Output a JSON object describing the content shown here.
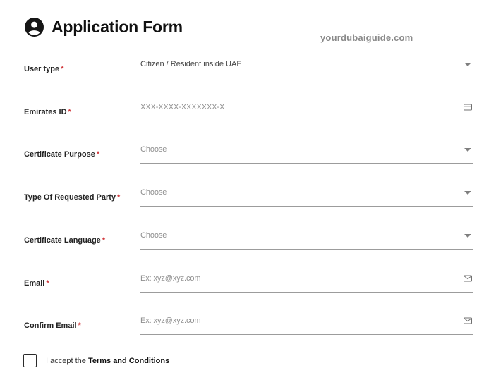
{
  "form": {
    "title": "Application Form",
    "watermark": "yourdubaiguide.com",
    "required_marker": "*",
    "fields": [
      {
        "label": "User type",
        "value": "Citizen / Resident inside UAE",
        "kind": "dropdown",
        "icon": "chevron-down-icon"
      },
      {
        "label": "Emirates ID",
        "placeholder": "XXX-XXXX-XXXXXXX-X",
        "kind": "text",
        "icon": "id-card-icon"
      },
      {
        "label": "Certificate Purpose",
        "placeholder": "Choose",
        "kind": "dropdown",
        "icon": "chevron-down-icon"
      },
      {
        "label": "Type Of Requested Party",
        "placeholder": "Choose",
        "kind": "dropdown",
        "icon": "chevron-down-icon"
      },
      {
        "label": "Certificate Language",
        "placeholder": "Choose",
        "kind": "dropdown",
        "icon": "chevron-down-icon"
      },
      {
        "label": "Email",
        "placeholder": "Ex: xyz@xyz.com",
        "kind": "text",
        "icon": "envelope-icon"
      },
      {
        "label": "Confirm Email",
        "placeholder": "Ex: xyz@xyz.com",
        "kind": "text",
        "icon": "envelope-icon"
      }
    ],
    "terms": {
      "prefix": "I accept the",
      "link": "Terms and Conditions",
      "checked": false
    }
  },
  "colors": {
    "required": "#d0363a",
    "active_underline": "#2ba79b",
    "underline": "#9c9c9c"
  }
}
